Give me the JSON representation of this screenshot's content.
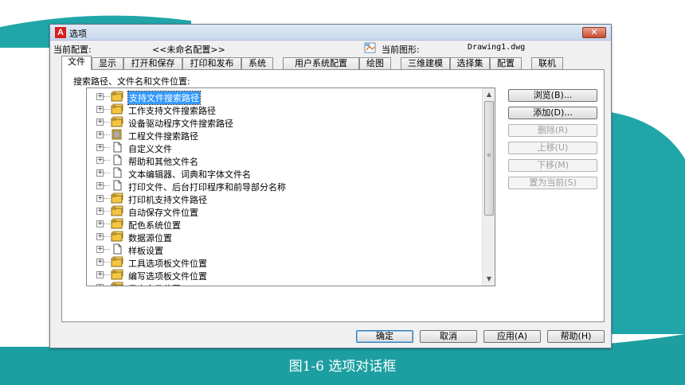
{
  "dialog": {
    "title": "选项",
    "app_icon": "A",
    "close_glyph": "✕",
    "current_profile_label": "当前配置:",
    "current_profile_value": "<<未命名配置>>",
    "current_drawing_label": "当前图形:",
    "current_drawing_value": "Drawing1.dwg"
  },
  "tabs": [
    {
      "label": "文件",
      "active": true
    },
    {
      "label": "显示"
    },
    {
      "label": "打开和保存"
    },
    {
      "label": "打印和发布"
    },
    {
      "label": "系统"
    },
    {
      "label": "用户系统配置"
    },
    {
      "label": "绘图"
    },
    {
      "label": "三维建模"
    },
    {
      "label": "选择集"
    },
    {
      "label": "配置"
    },
    {
      "label": "联机"
    }
  ],
  "file_tab": {
    "search_label": "搜索路径、文件名和文件位置:",
    "tree_items": [
      {
        "label": "支持文件搜索路径",
        "icon": "folder-stack-icon",
        "selected": true
      },
      {
        "label": "工作支持文件搜索路径",
        "icon": "folder-stack-icon"
      },
      {
        "label": "设备驱动程序文件搜索路径",
        "icon": "folder-stack-icon"
      },
      {
        "label": "工程文件搜索路径",
        "icon": "project-icon"
      },
      {
        "label": "自定义文件",
        "icon": "document-icon"
      },
      {
        "label": "帮助和其他文件名",
        "icon": "document-icon"
      },
      {
        "label": "文本编辑器、词典和字体文件名",
        "icon": "document-icon"
      },
      {
        "label": "打印文件、后台打印程序和前导部分名称",
        "icon": "document-icon"
      },
      {
        "label": "打印机支持文件路径",
        "icon": "folder-stack-icon"
      },
      {
        "label": "自动保存文件位置",
        "icon": "folder-stack-icon"
      },
      {
        "label": "配色系统位置",
        "icon": "folder-stack-icon"
      },
      {
        "label": "数据源位置",
        "icon": "folder-stack-icon"
      },
      {
        "label": "样板设置",
        "icon": "document-icon"
      },
      {
        "label": "工具选项板文件位置",
        "icon": "folder-stack-icon"
      },
      {
        "label": "编写选项板文件位置",
        "icon": "folder-stack-icon"
      },
      {
        "label": "日志文件位置",
        "icon": "folder-stack-icon"
      }
    ],
    "buttons": {
      "browse": "浏览(B)...",
      "add": "添加(D)...",
      "remove": "删除(R)",
      "move_up": "上移(U)",
      "move_down": "下移(M)",
      "set_current": "置为当前(S)"
    }
  },
  "footer": {
    "ok": "确定",
    "cancel": "取消",
    "apply": "应用(A)",
    "help": "帮助(H)"
  },
  "caption": "图1-6   选项对话框",
  "colors": {
    "teal": "#20a6a8",
    "selection": "#3399ff",
    "caption_text": "#ffffff"
  }
}
